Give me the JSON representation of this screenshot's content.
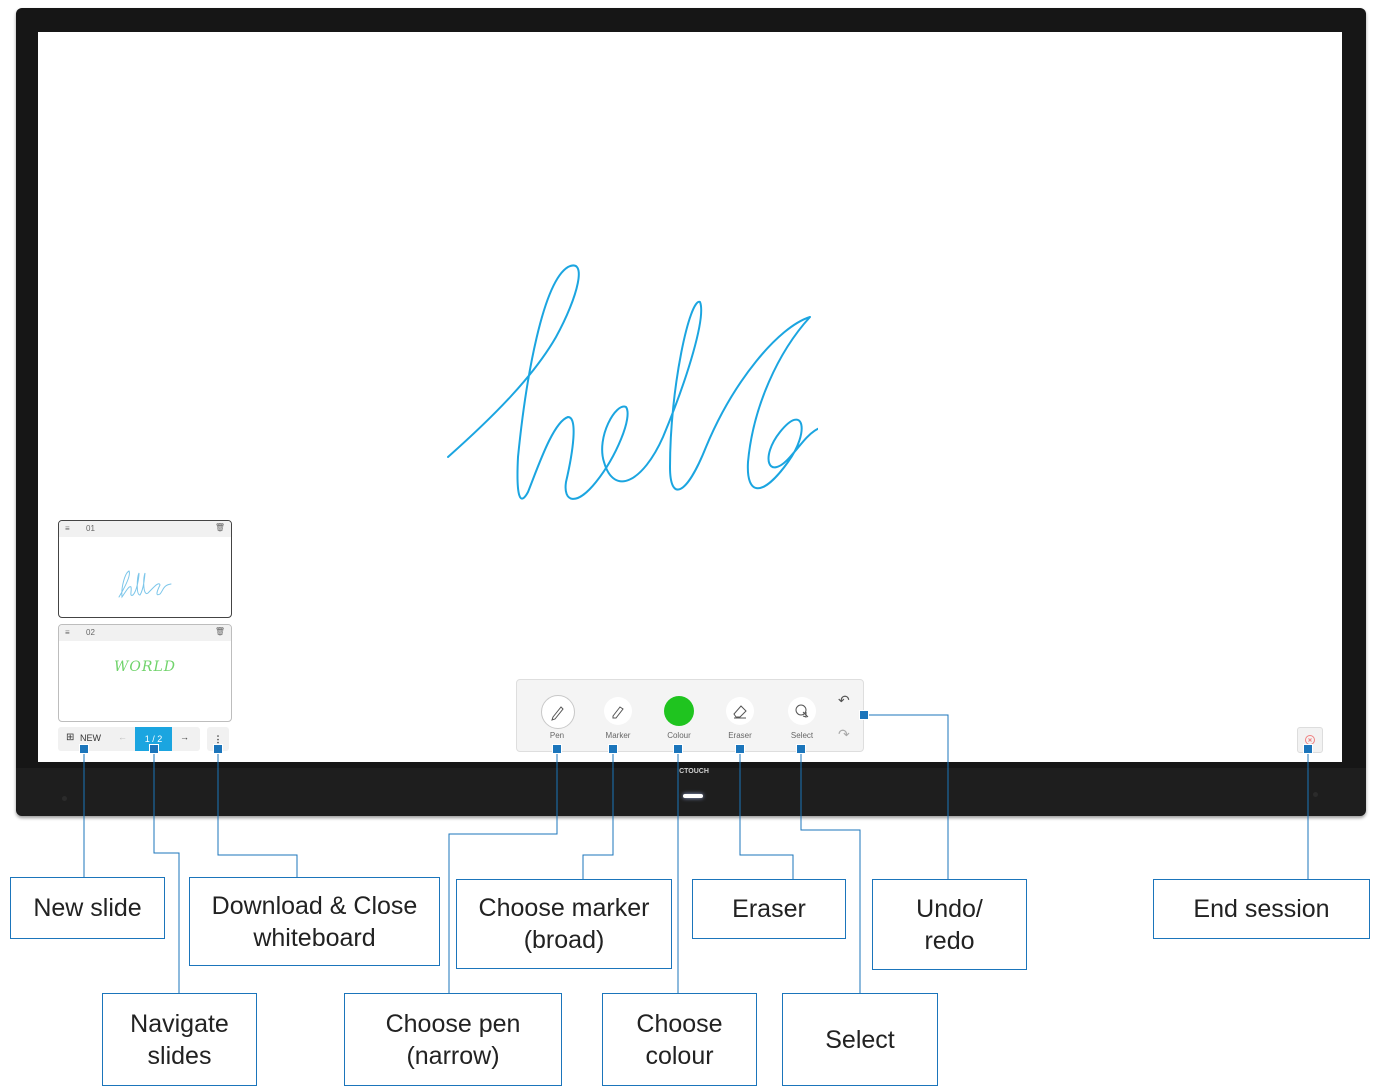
{
  "slides_panel": {
    "thumbnails": [
      {
        "number": "01",
        "content": "hello"
      },
      {
        "number": "02",
        "content": "WORLD"
      }
    ],
    "new_label": "NEW",
    "page_indicator": "1 / 2",
    "prev_arrow": "←",
    "next_arrow": "→",
    "more_icon": "⋮"
  },
  "canvas": {
    "drawing": "hello",
    "stroke_color": "#1ba5e0"
  },
  "toolbar": {
    "tools": [
      {
        "label": "Pen",
        "icon": "pen-icon",
        "selected": true
      },
      {
        "label": "Marker",
        "icon": "marker-icon"
      },
      {
        "label": "Colour",
        "icon": "colour-swatch",
        "color": "#1fc41f"
      },
      {
        "label": "Eraser",
        "icon": "eraser-icon"
      },
      {
        "label": "Select",
        "icon": "select-icon"
      }
    ],
    "undo_icon": "↶",
    "redo_icon": "↷"
  },
  "bezel": {
    "brand": "CTOUCH"
  },
  "callouts": {
    "new_slide": "New slide",
    "navigate_slides": "Navigate slides",
    "download_close": "Download & Close whiteboard",
    "choose_pen": "Choose pen (narrow)",
    "choose_marker": "Choose marker (broad)",
    "choose_colour": "Choose colour",
    "eraser": "Eraser",
    "select": "Select",
    "undo_redo": "Undo/ redo",
    "end_session": "End session"
  },
  "accent_color": "#1b75bb"
}
